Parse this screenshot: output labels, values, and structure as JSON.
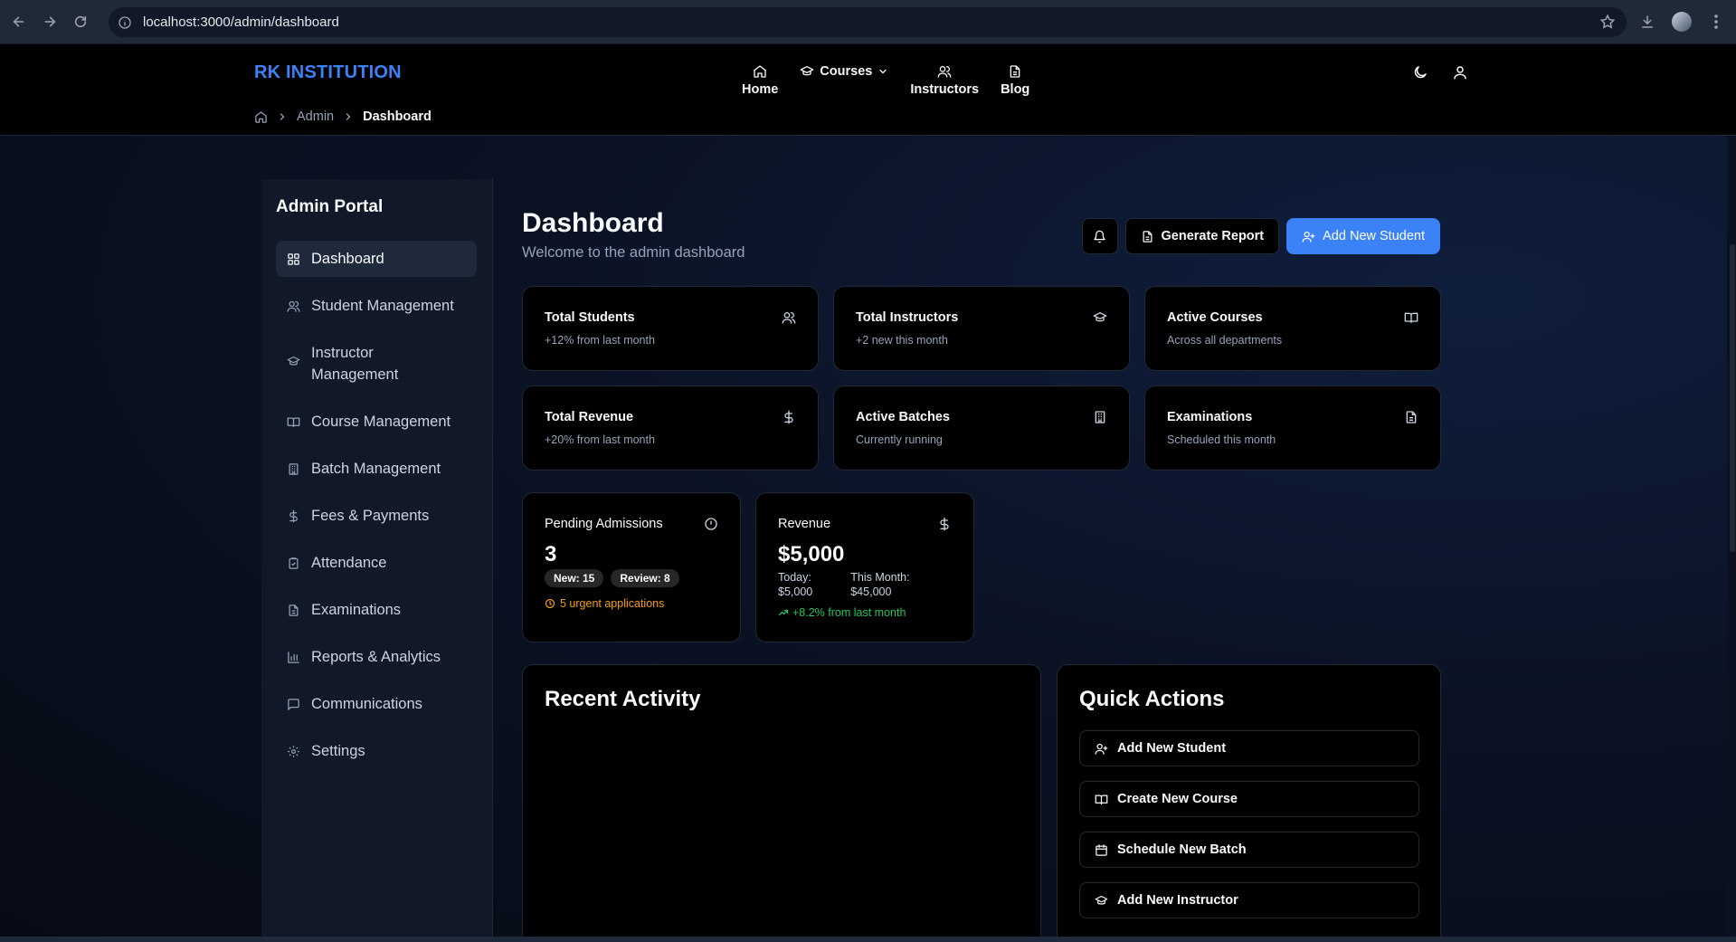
{
  "browser": {
    "url": "localhost:3000/admin/dashboard"
  },
  "header": {
    "brand": "RK INSTITUTION",
    "nav": [
      {
        "label": "Home",
        "icon": "home-icon"
      },
      {
        "label": "Courses",
        "icon": "graduation-cap-icon"
      },
      {
        "label": "Instructors",
        "icon": "users-icon"
      },
      {
        "label": "Blog",
        "icon": "file-text-icon"
      }
    ],
    "breadcrumb": [
      "Admin",
      "Dashboard"
    ]
  },
  "sidebar": {
    "title": "Admin Portal",
    "items": [
      {
        "label": "Dashboard",
        "icon": "grid-icon",
        "active": true
      },
      {
        "label": "Student Management",
        "icon": "users-icon"
      },
      {
        "label": "Instructor Management",
        "icon": "graduation-cap-icon"
      },
      {
        "label": "Course Management",
        "icon": "book-open-icon"
      },
      {
        "label": "Batch Management",
        "icon": "building-icon"
      },
      {
        "label": "Fees & Payments",
        "icon": "dollar-icon"
      },
      {
        "label": "Attendance",
        "icon": "clipboard-check-icon"
      },
      {
        "label": "Examinations",
        "icon": "file-text-icon"
      },
      {
        "label": "Reports & Analytics",
        "icon": "bar-chart-icon"
      },
      {
        "label": "Communications",
        "icon": "message-square-icon"
      },
      {
        "label": "Settings",
        "icon": "gear-icon"
      }
    ]
  },
  "main": {
    "title": "Dashboard",
    "subtitle": "Welcome to the admin dashboard",
    "actions": {
      "generate_report": "Generate Report",
      "add_student": "Add New Student"
    },
    "stats": [
      {
        "title": "Total Students",
        "sub": "+12% from last month",
        "icon": "users-icon"
      },
      {
        "title": "Total Instructors",
        "sub": "+2 new this month",
        "icon": "graduation-cap-icon"
      },
      {
        "title": "Active Courses",
        "sub": "Across all departments",
        "icon": "book-open-icon"
      },
      {
        "title": "Total Revenue",
        "sub": "+20% from last month",
        "icon": "dollar-icon"
      },
      {
        "title": "Active Batches",
        "sub": "Currently running",
        "icon": "building-icon"
      },
      {
        "title": "Examinations",
        "sub": "Scheduled this month",
        "icon": "file-text-icon"
      }
    ],
    "pending": {
      "title": "Pending Admissions",
      "value": "3",
      "pill_new": "New: 15",
      "pill_review": "Review: 8",
      "urgent": "5 urgent applications"
    },
    "revenue": {
      "title": "Revenue",
      "value": "$5,000",
      "today_label": "Today:",
      "today_value": "$5,000",
      "month_label": "This Month:",
      "month_value": "$45,000",
      "trend": "+8.2% from last month"
    },
    "recent_activity": {
      "title": "Recent Activity"
    },
    "quick_actions": {
      "title": "Quick Actions",
      "items": [
        {
          "label": "Add New Student",
          "icon": "user-plus-icon"
        },
        {
          "label": "Create New Course",
          "icon": "book-open-icon"
        },
        {
          "label": "Schedule New Batch",
          "icon": "calendar-icon"
        },
        {
          "label": "Add New Instructor",
          "icon": "graduation-cap-icon"
        }
      ]
    }
  },
  "colors": {
    "accent": "#3b82f6",
    "warning": "#f59e0b",
    "success": "#22c55e",
    "background": "#0b1120"
  }
}
